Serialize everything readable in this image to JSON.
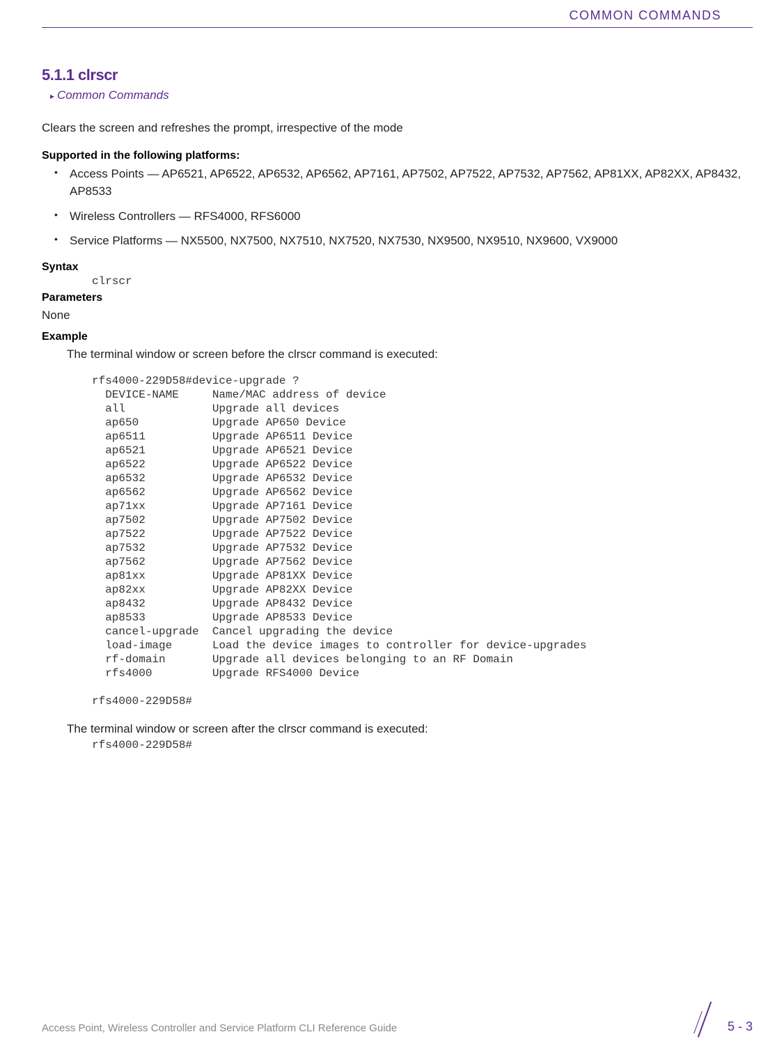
{
  "header": {
    "running_head": "COMMON COMMANDS"
  },
  "section": {
    "number_title": "5.1.1 clrscr",
    "breadcrumb": "Common Commands",
    "description": "Clears the screen and refreshes the prompt, irrespective of the mode"
  },
  "platforms": {
    "heading": "Supported in the following platforms:",
    "items": [
      "Access Points — AP6521, AP6522, AP6532, AP6562, AP7161, AP7502, AP7522, AP7532, AP7562, AP81XX, AP82XX, AP8432, AP8533",
      "Wireless Controllers — RFS4000, RFS6000",
      "Service Platforms — NX5500, NX7500, NX7510, NX7520, NX7530, NX9500, NX9510, NX9600, VX9000"
    ]
  },
  "syntax": {
    "label": "Syntax",
    "code": "clrscr"
  },
  "parameters": {
    "label": "Parameters",
    "value": "None"
  },
  "example": {
    "label": "Example",
    "intro_before": "The terminal window or screen before the clrscr command is executed:",
    "code_before": "rfs4000-229D58#device-upgrade ?\n  DEVICE-NAME     Name/MAC address of device\n  all             Upgrade all devices\n  ap650           Upgrade AP650 Device\n  ap6511          Upgrade AP6511 Device\n  ap6521          Upgrade AP6521 Device\n  ap6522          Upgrade AP6522 Device\n  ap6532          Upgrade AP6532 Device\n  ap6562          Upgrade AP6562 Device\n  ap71xx          Upgrade AP7161 Device\n  ap7502          Upgrade AP7502 Device\n  ap7522          Upgrade AP7522 Device\n  ap7532          Upgrade AP7532 Device\n  ap7562          Upgrade AP7562 Device\n  ap81xx          Upgrade AP81XX Device\n  ap82xx          Upgrade AP82XX Device\n  ap8432          Upgrade AP8432 Device\n  ap8533          Upgrade AP8533 Device\n  cancel-upgrade  Cancel upgrading the device\n  load-image      Load the device images to controller for device-upgrades\n  rf-domain       Upgrade all devices belonging to an RF Domain\n  rfs4000         Upgrade RFS4000 Device\n\nrfs4000-229D58#",
    "intro_after": "The terminal window or screen after the clrscr command is executed:",
    "code_after": "rfs4000-229D58#"
  },
  "footer": {
    "guide": "Access Point, Wireless Controller and Service Platform CLI Reference Guide",
    "page": "5 - 3"
  }
}
